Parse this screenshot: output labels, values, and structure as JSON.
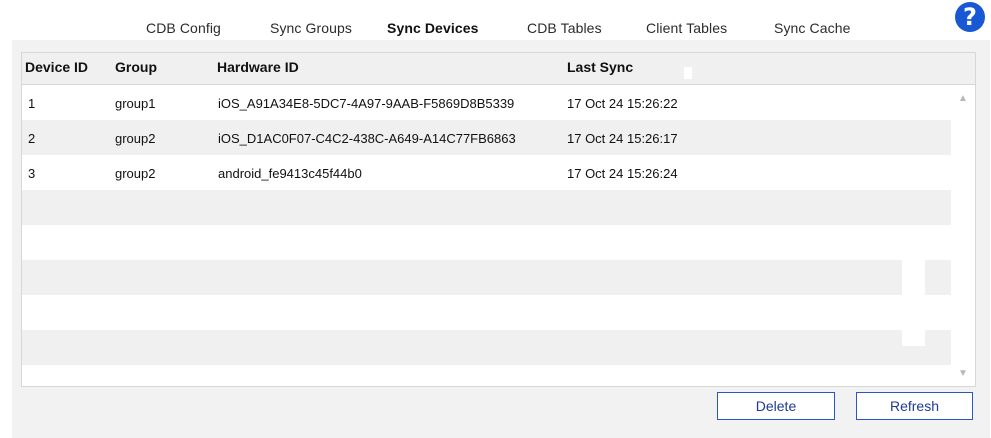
{
  "tabs": [
    {
      "label": "CDB Config"
    },
    {
      "label": "Sync Groups"
    },
    {
      "label": "Sync Devices"
    },
    {
      "label": "CDB Tables"
    },
    {
      "label": "Client Tables"
    },
    {
      "label": "Sync Cache"
    }
  ],
  "active_tab": "Sync Devices",
  "help": {
    "glyph": "?"
  },
  "table": {
    "columns": [
      "Device ID",
      "Group",
      "Hardware ID",
      "Last Sync"
    ],
    "rows": [
      {
        "device_id": "1",
        "group": "group1",
        "hardware_id": "iOS_A91A34E8-5DC7-4A97-9AAB-F5869D8B5339",
        "last_sync": "17 Oct 24 15:26:22"
      },
      {
        "device_id": "2",
        "group": "group2",
        "hardware_id": "iOS_D1AC0F07-C4C2-438C-A649-A14C77FB6863",
        "last_sync": "17 Oct 24 15:26:17"
      },
      {
        "device_id": "3",
        "group": "group2",
        "hardware_id": "android_fe9413c45f44b0",
        "last_sync": "17 Oct 24 15:26:24"
      }
    ]
  },
  "scrollbar": {
    "up_icon": "chevron-up-icon",
    "down_icon": "chevron-down-icon"
  },
  "buttons": {
    "delete": "Delete",
    "refresh": "Refresh"
  },
  "colors": {
    "accent": "#2c56c4",
    "help": "#1858d4",
    "row_alt": "#f0f0f0"
  }
}
